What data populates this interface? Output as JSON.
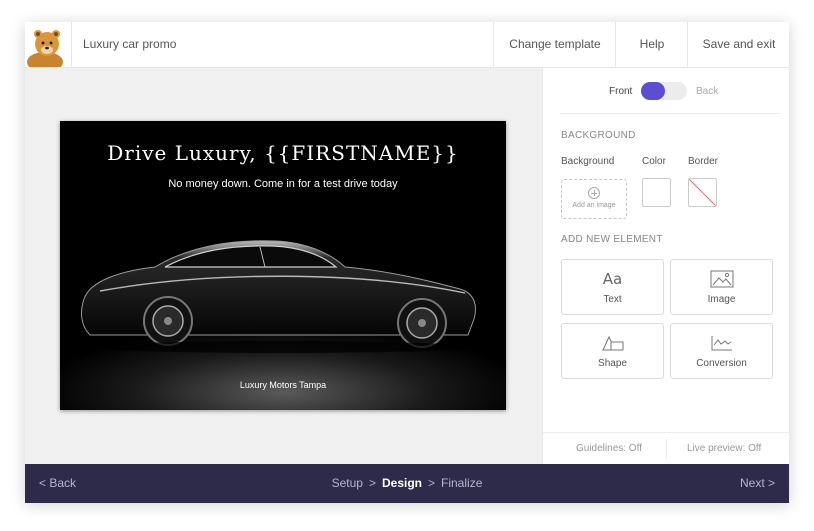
{
  "header": {
    "doc_title": "Luxury car promo",
    "change_template": "Change template",
    "help": "Help",
    "save_exit": "Save and exit"
  },
  "card": {
    "headline": "Drive Luxury, {{FIRSTNAME}}",
    "subline": "No money down. Come in for a test drive today",
    "footer": "Luxury Motors Tampa"
  },
  "panel": {
    "face": {
      "front": "Front",
      "back": "Back",
      "selected": "Front"
    },
    "background_section": "BACKGROUND",
    "background_label": "Background",
    "color_label": "Color",
    "border_label": "Border",
    "add_image": "Add an image",
    "add_element_section": "ADD NEW ELEMENT",
    "elements": [
      {
        "label": "Text",
        "icon": "text-aa-icon"
      },
      {
        "label": "Image",
        "icon": "image-icon"
      },
      {
        "label": "Shape",
        "icon": "shape-icon"
      },
      {
        "label": "Conversion",
        "icon": "conversion-icon"
      }
    ],
    "guidelines": "Guidelines: Off",
    "live_preview": "Live preview: Off"
  },
  "bottombar": {
    "back": "< Back",
    "next": "Next >",
    "steps": [
      "Setup",
      "Design",
      "Finalize"
    ],
    "active_step": "Design",
    "separator": ">"
  },
  "colors": {
    "accent": "#5b4fcf",
    "bottombar_bg": "#2e2a4a",
    "canvas_bg": "#f0f0f0"
  }
}
